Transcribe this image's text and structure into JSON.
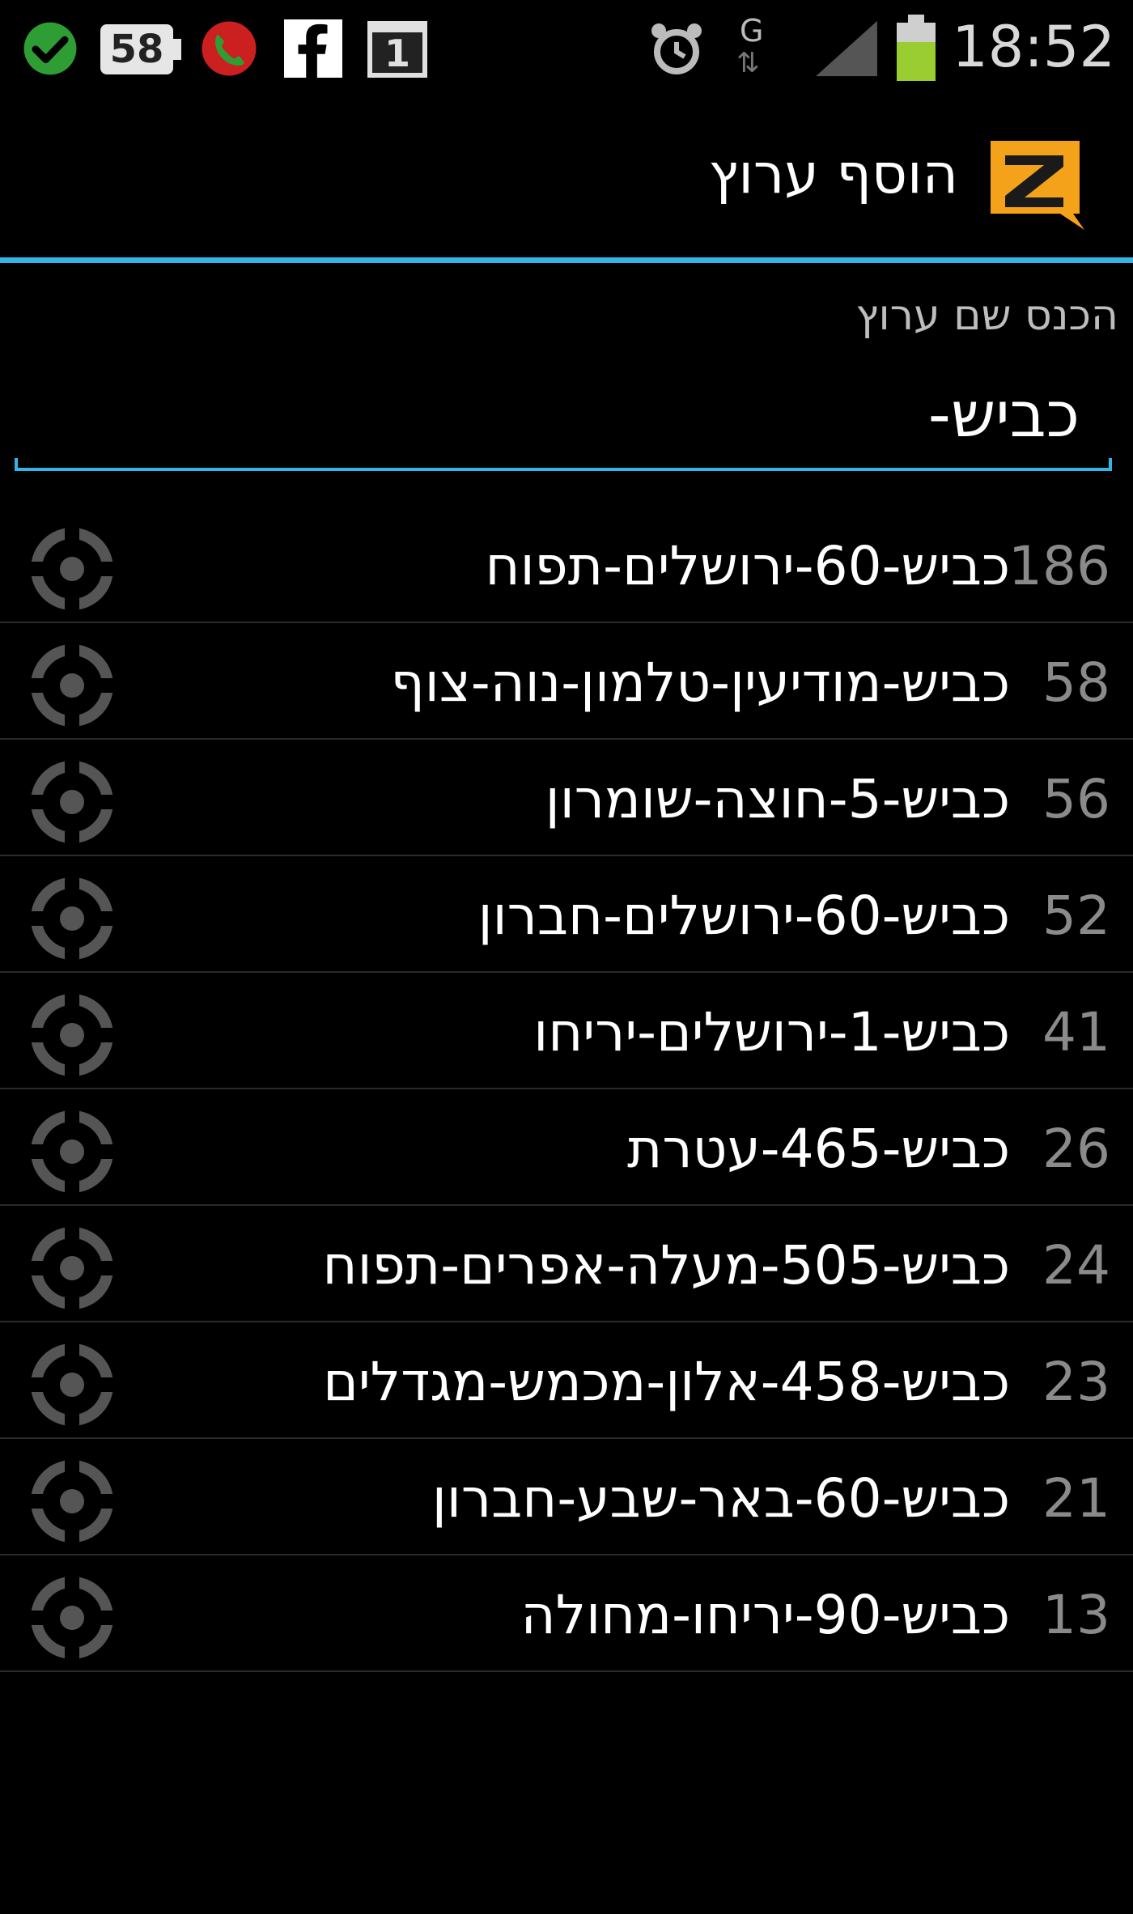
{
  "status_bar": {
    "icons": [
      "check-circle-icon",
      "battery-58-badge-icon",
      "call-icon",
      "facebook-icon",
      "calendar-icon",
      "alarm-icon",
      "data-g-icon",
      "signal-icon",
      "battery-icon"
    ],
    "battery_badge": "58",
    "calendar_day": "1",
    "network_type": "G",
    "time": "18:52"
  },
  "action_bar": {
    "title": "הוסף ערוץ",
    "logo": "zello-logo-icon"
  },
  "input": {
    "label": "הכנס שם ערוץ",
    "value": "כביש-"
  },
  "channels": [
    {
      "count": "186",
      "name": "כביש-60-ירושלים-תפוח"
    },
    {
      "count": "58",
      "name": "כביש-מודיעין-טלמון-נוה-צוף"
    },
    {
      "count": "56",
      "name": "כביש-5-חוצה-שומרון"
    },
    {
      "count": "52",
      "name": "כביש-60-ירושלים-חברון"
    },
    {
      "count": "41",
      "name": "כביש-1-ירושלים-יריחו"
    },
    {
      "count": "26",
      "name": "כביש-465-עטרת"
    },
    {
      "count": "24",
      "name": "כביש-505-מעלה-אפרים-תפוח"
    },
    {
      "count": "23",
      "name": "כביש-458-אלון-מכמש-מגדלים"
    },
    {
      "count": "21",
      "name": "כביש-60-באר-שבע-חברון"
    },
    {
      "count": "13",
      "name": "כביש-90-יריחו-מחולה"
    }
  ],
  "colors": {
    "accent": "#33b5e5",
    "logo_orange": "#f5a21b",
    "status_icon_gray": "#555555"
  }
}
